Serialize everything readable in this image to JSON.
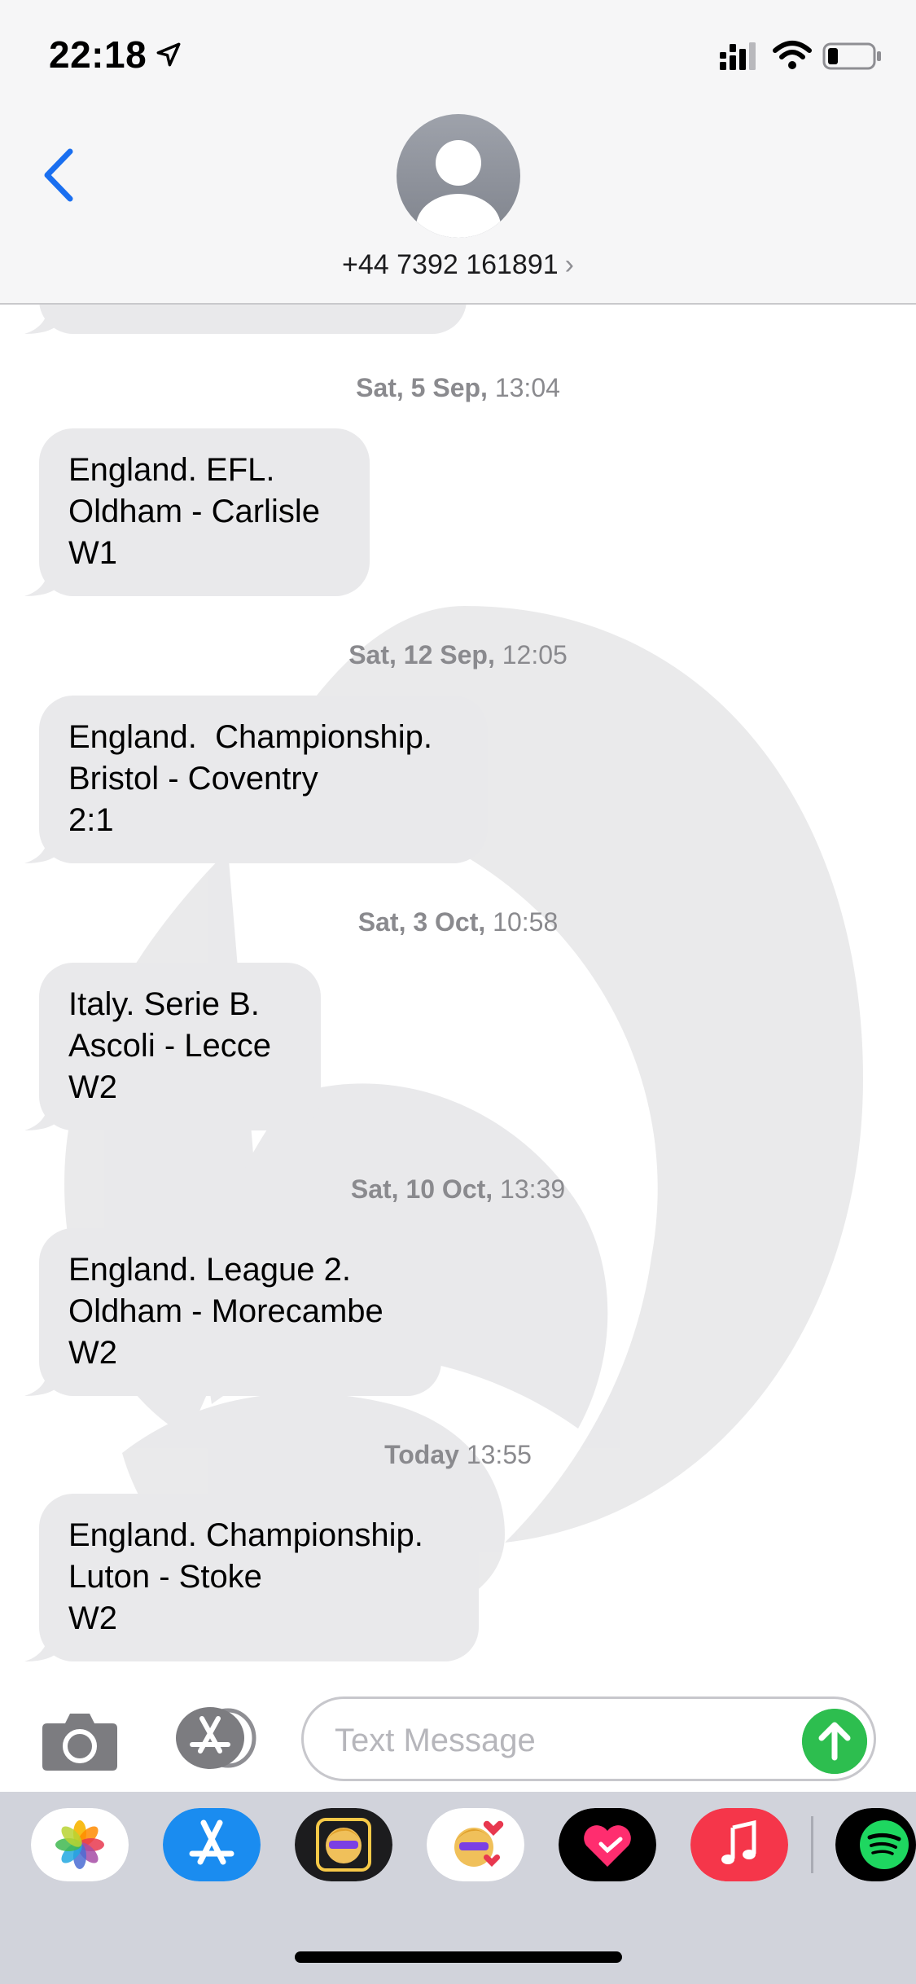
{
  "status_bar": {
    "time": "22:18",
    "icons": [
      "location-arrow-icon",
      "cellular-signal-icon",
      "wifi-icon",
      "battery-icon"
    ]
  },
  "header": {
    "contact": "+44 7392 161891",
    "back_icon": "chevron-left-icon",
    "avatar_icon": "person-silhouette-icon"
  },
  "messages": [
    {
      "timestamp_day": "Sat, 5 Sep,",
      "timestamp_time": "13:04",
      "lines": [
        "England. EFL.",
        "Oldham - Carlisle",
        "W1"
      ]
    },
    {
      "timestamp_day": "Sat, 12 Sep,",
      "timestamp_time": "12:05",
      "lines": [
        "England.  Championship.",
        "Bristol - Coventry",
        "2:1"
      ]
    },
    {
      "timestamp_day": "Sat, 3 Oct,",
      "timestamp_time": "10:58",
      "lines": [
        "Italy. Serie B.",
        "Ascoli - Lecce",
        "W2"
      ]
    },
    {
      "timestamp_day": "Sat, 10 Oct,",
      "timestamp_time": "13:39",
      "lines": [
        "England. League 2.",
        "Oldham - Morecambe",
        "W2"
      ]
    },
    {
      "timestamp_day": "Today",
      "timestamp_time": "13:55",
      "lines": [
        "England. Championship.",
        "Luton - Stoke",
        "W2"
      ]
    }
  ],
  "input_bar": {
    "placeholder": "Text Message",
    "camera_icon": "camera-icon",
    "apps_icon": "app-store-icon",
    "send_icon": "send-arrow-icon"
  },
  "app_drawer": [
    "Photos",
    "App Store",
    "Memoji",
    "Memoji Stickers",
    "Digital Touch",
    "Music",
    "Spotify"
  ],
  "colors": {
    "bubble": "#e9e9eb",
    "accent": "#1a73e8",
    "send": "#2dbe4f",
    "dock": "#d1d3db"
  }
}
